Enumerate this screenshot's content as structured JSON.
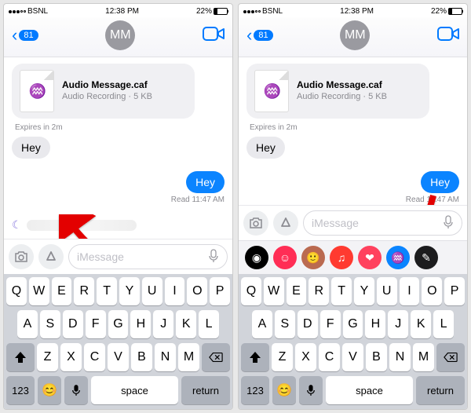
{
  "status": {
    "carrier": "BSNL",
    "time": "12:38 PM",
    "battery_pct": "22%"
  },
  "nav": {
    "back_count": "81",
    "avatar_initials": "MM"
  },
  "messages": {
    "audio": {
      "title": "Audio Message.caf",
      "subtitle": "Audio Recording · 5 KB"
    },
    "expires": "Expires in 2m",
    "incoming": "Hey",
    "outgoing": "Hey",
    "read_receipt": "Read 11:47 AM"
  },
  "input": {
    "placeholder": "iMessage"
  },
  "keyboard": {
    "row1": [
      "Q",
      "W",
      "E",
      "R",
      "T",
      "Y",
      "U",
      "I",
      "O",
      "P"
    ],
    "row2": [
      "A",
      "S",
      "D",
      "F",
      "G",
      "H",
      "J",
      "K",
      "L"
    ],
    "row3": [
      "Z",
      "X",
      "C",
      "V",
      "B",
      "N",
      "M"
    ],
    "num_label": "123",
    "space_label": "space",
    "return_label": "return"
  },
  "apps": [
    {
      "name": "activity",
      "bg": "#000"
    },
    {
      "name": "animoji",
      "bg": "#ff2d55"
    },
    {
      "name": "memoji",
      "bg": "#ba6a50"
    },
    {
      "name": "apple-music",
      "bg": "#ff3a30"
    },
    {
      "name": "digital-touch",
      "bg": "#ff415e"
    },
    {
      "name": "audio",
      "bg": "#0a84ff"
    },
    {
      "name": "images",
      "bg": "#1c1c1e"
    }
  ]
}
